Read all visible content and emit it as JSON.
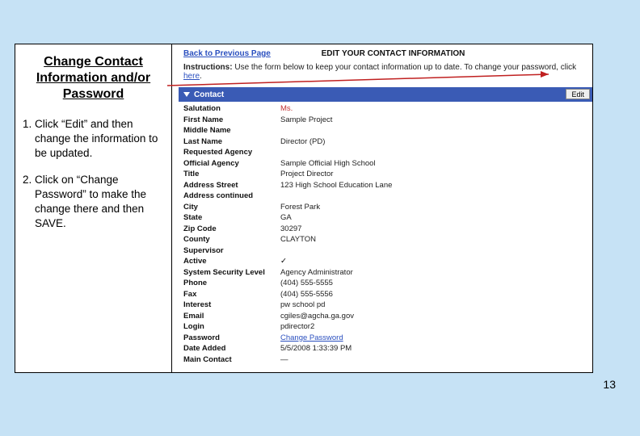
{
  "left": {
    "heading": "Change Contact Information and/or Password",
    "step1": "Click “Edit” and then change the information to be updated.",
    "step2": "Click on “Change Password” to make the change there and then SAVE."
  },
  "screen": {
    "back": "Back to Previous Page",
    "title": "EDIT YOUR CONTACT INFORMATION",
    "instructions_label": "Instructions:",
    "instructions_text": "Use the form below to keep your contact information up to date. To change your password, click",
    "here": "here",
    "contact_header": "Contact",
    "edit_btn": "Edit",
    "fields": {
      "salutation_l": "Salutation",
      "salutation_v": "Ms.",
      "first_l": "First Name",
      "first_v": "Sample Project",
      "middle_l": "Middle Name",
      "middle_v": "",
      "last_l": "Last Name",
      "last_v": "Director (PD)",
      "reqagency_l": "Requested Agency",
      "reqagency_v": "",
      "offagency_l": "Official Agency",
      "offagency_v": "Sample Official High School",
      "title_l": "Title",
      "title_v": "Project Director",
      "address_l": "Address Street",
      "address_v": "123 High School Education Lane",
      "address2_l": "Address continued",
      "address2_v": "",
      "city_l": "City",
      "city_v": "Forest Park",
      "state_l": "State",
      "state_v": "GA",
      "zip_l": "Zip Code",
      "zip_v": "30297",
      "county_l": "County",
      "county_v": "CLAYTON",
      "supervisor_l": "Supervisor",
      "supervisor_v": "",
      "active_l": "Active",
      "active_v": "✓",
      "seclevel_l": "System Security Level",
      "seclevel_v": "Agency Administrator",
      "phone_l": "Phone",
      "phone_v": "(404) 555-5555",
      "fax_l": "Fax",
      "fax_v": "(404) 555-5556",
      "interest_l": "Interest",
      "interest_v": "pw school pd",
      "email_l": "Email",
      "email_v": "cgiles@agcha.ga.gov",
      "login_l": "Login",
      "login_v": "pdirector2",
      "password_l": "Password",
      "password_v": "Change Password",
      "dateadded_l": "Date Added",
      "dateadded_v": "5/5/2008 1:33:39 PM",
      "maincontact_l": "Main Contact",
      "maincontact_v": "—"
    }
  },
  "page_number": "13"
}
